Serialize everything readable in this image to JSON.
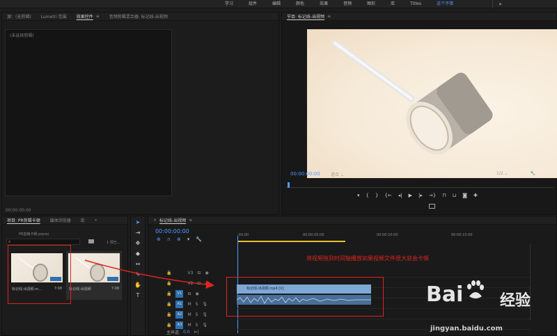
{
  "workspace": {
    "tabs": [
      "学习",
      "组件",
      "编辑",
      "颜色",
      "效果",
      "音频",
      "图形",
      "库",
      "Titles",
      "这个不错"
    ],
    "active_tab": "这个不错",
    "more": "»"
  },
  "source_panel": {
    "tabs": [
      "源：(无剪辑)",
      "Lumetri 范围",
      "效果控件",
      "音频剪辑混合器: 标记线-出视频"
    ],
    "active": "效果控件",
    "menu_icon": "≡",
    "no_selection": "(未选择剪辑)",
    "timecode": "00:00:00:00"
  },
  "program_monitor": {
    "title": "节目: 标记线-出视频",
    "menu_icon": "≡",
    "timecode": "00:00:00:00",
    "fit": "适合",
    "resolution": "1/2"
  },
  "project_panel": {
    "tabs": [
      "项目: PR剪辑卡顿",
      "媒体浏览器",
      "库"
    ],
    "active": "项目: PR剪辑卡顿",
    "more": "»",
    "path": "PR剪辑卡顿.prproj",
    "item_count": "1 项已…",
    "items": [
      {
        "name": "标记线-出视频.m...",
        "duration": "7:08"
      },
      {
        "name": "标记线-出视频",
        "duration": "7:08"
      }
    ]
  },
  "timeline": {
    "title": "标记线-出视频",
    "menu_icon": "≡",
    "timecode": "00:00:00:00",
    "ruler_labels": [
      ":00:00",
      "00:00:05:00",
      "00:00:10:00",
      "00:00:15:00"
    ],
    "tracks": [
      {
        "name": "V3",
        "target": ""
      },
      {
        "name": "V2",
        "target": ""
      },
      {
        "name": "V1",
        "target": "V1"
      },
      {
        "name": "A1",
        "target": "A1"
      },
      {
        "name": "A2",
        "target": "A2"
      },
      {
        "name": "A3",
        "target": "A3"
      }
    ],
    "master": {
      "label": "主声道",
      "value": "0.0"
    },
    "clip_video_label": "标记线-出视频.mp4 [V]",
    "audio_btns": [
      "M",
      "S"
    ]
  },
  "annotation": "将视频拖到时间轴播放如果视频文件很大就会卡顿",
  "watermark": {
    "logo": "Bai",
    "cn": "经验",
    "url": "jingyan.baidu.com"
  }
}
